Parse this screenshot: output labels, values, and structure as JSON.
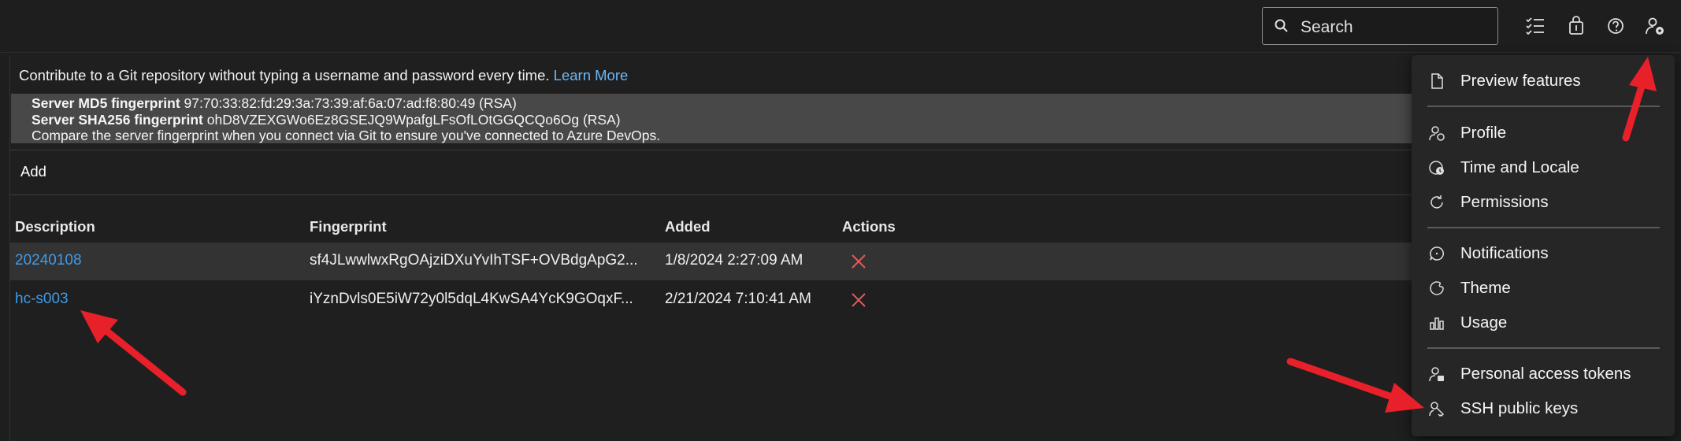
{
  "header": {
    "search_placeholder": "Search",
    "icons": [
      "search-icon",
      "task-list-icon",
      "shopping-bag-icon",
      "help-icon",
      "user-settings-icon"
    ]
  },
  "page": {
    "intro_text": "Contribute to a Git repository without typing a username and password every time.",
    "learn_more": "Learn More",
    "fingerprint_md5_label": "Server MD5 fingerprint",
    "fingerprint_md5_value": "97:70:33:82:fd:29:3a:73:39:af:6a:07:ad:f8:80:49 (RSA)",
    "fingerprint_sha256_label": "Server SHA256 fingerprint",
    "fingerprint_sha256_value": "ohD8VZEXGWo6Ez8GSEJQ9WpafgLFsOfLOtGGQCQo6Og (RSA)",
    "compare_note": "Compare the server fingerprint when you connect via Git to ensure you've connected to Azure DevOps.",
    "add_label": "Add"
  },
  "table": {
    "columns": [
      "Description",
      "Fingerprint",
      "Added",
      "Actions"
    ],
    "rows": [
      {
        "description": "20240108",
        "fingerprint": "sf4JLwwlwxRgOAjziDXuYvIhTSF+OVBdgApG2...",
        "added": "1/8/2024 2:27:09 AM"
      },
      {
        "description": "hc-s003",
        "fingerprint": "iYznDvls0E5iW72y0l5dqL4KwSA4YcK9GOqxF...",
        "added": "2/21/2024 7:10:41 AM"
      }
    ]
  },
  "menu": {
    "items": [
      {
        "label": "Preview features",
        "icon": "document-icon"
      },
      {
        "label": "Profile",
        "icon": "profile-icon"
      },
      {
        "label": "Time and Locale",
        "icon": "time-locale-icon"
      },
      {
        "label": "Permissions",
        "icon": "permissions-icon"
      },
      {
        "label": "Notifications",
        "icon": "notifications-icon"
      },
      {
        "label": "Theme",
        "icon": "theme-icon"
      },
      {
        "label": "Usage",
        "icon": "usage-icon"
      },
      {
        "label": "Personal access tokens",
        "icon": "personal-access-tokens-icon"
      },
      {
        "label": "SSH public keys",
        "icon": "ssh-keys-icon"
      }
    ]
  },
  "colors": {
    "background": "#1e1e1e",
    "link": "#3f9be8",
    "delete": "#e05a5a",
    "annotation_arrow": "#e8202a"
  }
}
